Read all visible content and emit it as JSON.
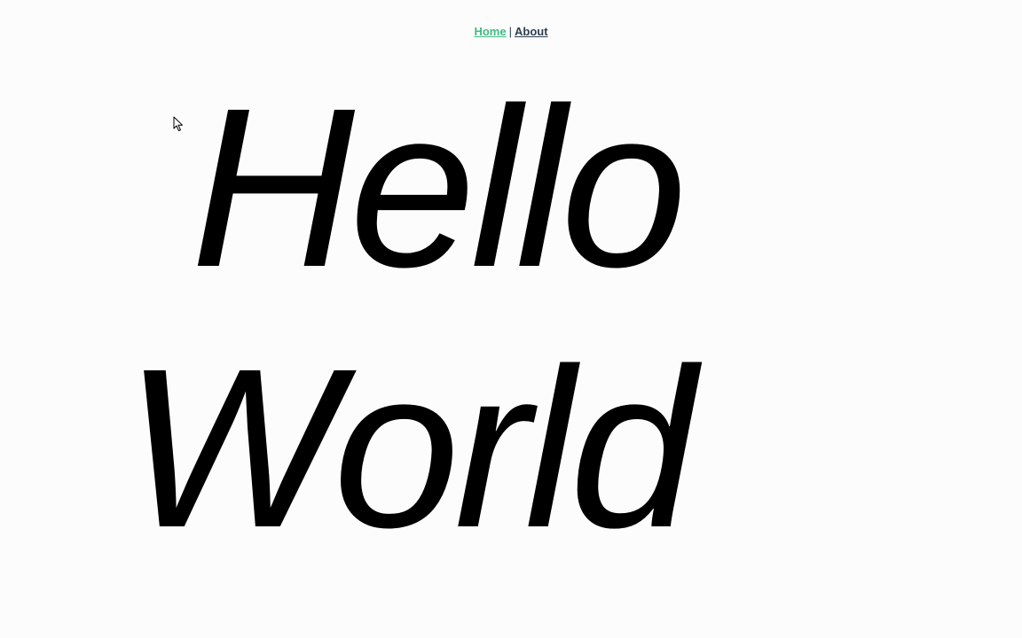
{
  "nav": {
    "items": [
      {
        "label": "Home",
        "active": true
      },
      {
        "label": "About",
        "active": false
      }
    ],
    "separator": "|",
    "active_color": "#42b983",
    "text_color": "#2c3e50"
  },
  "hero": {
    "line1": "Hello",
    "line2": "World"
  },
  "cursor": {
    "icon": "arrow-pointer-icon"
  }
}
